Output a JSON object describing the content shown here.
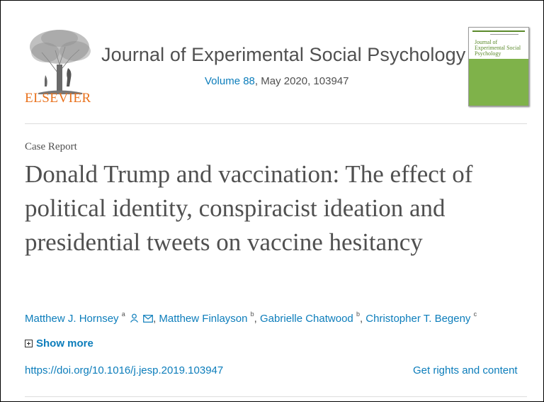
{
  "header": {
    "publisher_logo_text": "ELSEVIER",
    "journal_title": "Journal of Experimental Social Psychology",
    "volume_link": "Volume 88",
    "issue_rest": ", May 2020, 103947",
    "cover_title": "Journal of Experimental Social Psychology"
  },
  "article": {
    "type": "Case Report",
    "title": "Donald Trump and vaccination: The effect of political identity, conspiracist ideation and presidential tweets on vaccine hesitancy",
    "authors": [
      {
        "name": "Matthew J. Hornsey",
        "aff": "a"
      },
      {
        "name": "Matthew Finlayson",
        "aff": "b"
      },
      {
        "name": "Gabrielle Chatwood",
        "aff": "b"
      },
      {
        "name": "Christopher T. Begeny",
        "aff": "c"
      }
    ],
    "show_more": "Show more",
    "doi": "https://doi.org/10.1016/j.jesp.2019.103947",
    "rights": "Get rights and content"
  },
  "colors": {
    "link": "#0c7dbb",
    "elsevier_orange": "#e9711c",
    "cover_green": "#7fb24a",
    "text": "#505050"
  }
}
